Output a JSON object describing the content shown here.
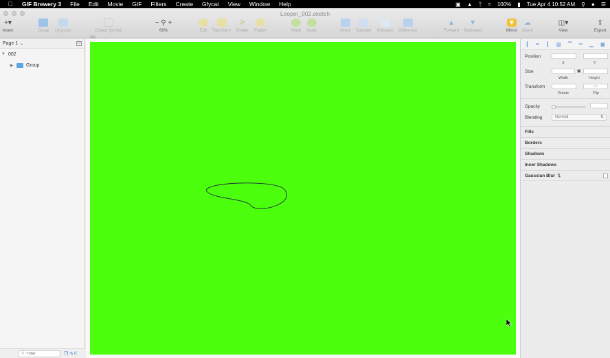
{
  "menubar": {
    "app_name": "GIF Brewery 3",
    "items": [
      "File",
      "Edit",
      "Movie",
      "GIF",
      "Filters",
      "Create",
      "Gfycat",
      "View",
      "Window",
      "Help"
    ],
    "battery": "100%",
    "datetime": "Tue Apr 4  10:52 AM"
  },
  "window": {
    "doc_title": "Looper_002.sketch"
  },
  "toolbar": {
    "insert": "Insert",
    "group": "Group",
    "ungroup": "Ungroup",
    "create_symbol": "Create Symbol",
    "zoom": "69%",
    "edit": "Edit",
    "transform": "Transform",
    "rotate": "Rotate",
    "flatten": "Flatten",
    "mask": "Mask",
    "scale": "Scale",
    "union": "Union",
    "subtract": "Subtract",
    "intersect": "Intersect",
    "difference": "Difference",
    "forward": "Forward",
    "backward": "Backward",
    "mirror": "Mirror",
    "cloud": "Cloud",
    "view": "View",
    "export": "Export"
  },
  "layers": {
    "page": "Page 1",
    "artboard": "002",
    "group": "Group",
    "filter_placeholder": "Filter",
    "count": "0"
  },
  "canvas": {
    "artboard_label": "002",
    "background": "#4bff0d"
  },
  "inspector": {
    "position": "Position",
    "x": "X",
    "y": "Y",
    "size": "Size",
    "width": "Width",
    "height": "Height",
    "transform": "Transform",
    "rotate": "Rotate",
    "flip": "Flip",
    "opacity": "Opacity",
    "blending": "Blending",
    "blend_mode": "Normal",
    "sections": [
      "Fills",
      "Borders",
      "Shadows",
      "Inner Shadows"
    ],
    "gaussian_blur": "Gaussian Blur"
  }
}
